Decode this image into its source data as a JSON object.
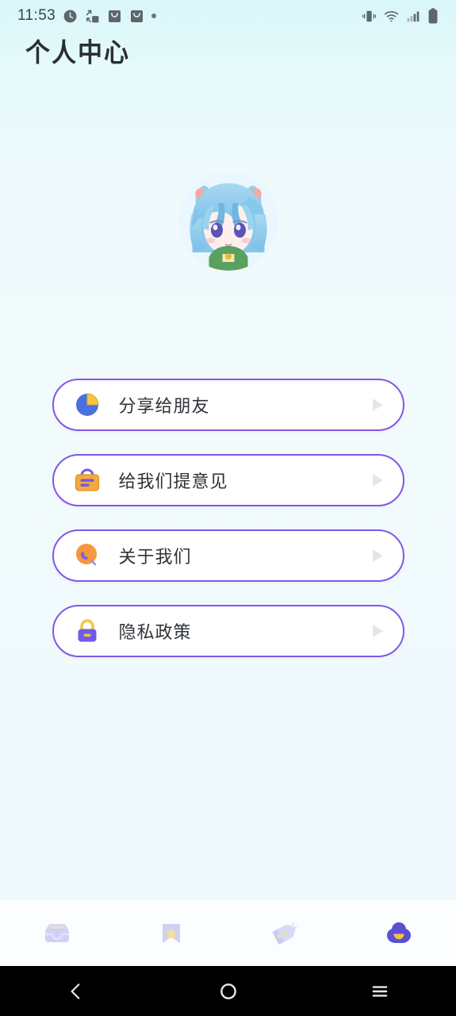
{
  "status_bar": {
    "time": "11:53",
    "left_icons": [
      "clock-icon",
      "shuffle-icon",
      "download-icon",
      "download-icon",
      "dot-icon"
    ],
    "right_icons": [
      "vibrate-icon",
      "wifi-icon",
      "signal-icon",
      "battery-icon"
    ]
  },
  "header": {
    "title": "个人中心"
  },
  "profile": {
    "avatar_name": "user-avatar",
    "avatar_alt": "anime-character-avatar"
  },
  "menu": {
    "items": [
      {
        "label": "分享给朋友",
        "icon": "share-pie-icon",
        "arrow": "play-arrow-icon"
      },
      {
        "label": "给我们提意见",
        "icon": "feedback-board-icon",
        "arrow": "play-arrow-icon"
      },
      {
        "label": "关于我们",
        "icon": "about-magnifier-icon",
        "arrow": "play-arrow-icon"
      },
      {
        "label": "隐私政策",
        "icon": "privacy-lock-icon",
        "arrow": "play-arrow-icon"
      }
    ]
  },
  "tabbar": {
    "items": [
      {
        "name": "tab-inbox",
        "icon": "inbox-box-icon",
        "active": false
      },
      {
        "name": "tab-favorites",
        "icon": "bookmark-star-icon",
        "active": false
      },
      {
        "name": "tab-tags",
        "icon": "price-tags-icon",
        "active": false
      },
      {
        "name": "tab-profile",
        "icon": "profile-cloud-icon",
        "active": true
      }
    ]
  },
  "navbar": {
    "back": "back-chevron-icon",
    "home": "home-circle-icon",
    "recents": "recents-menu-icon"
  },
  "colors": {
    "accent_purple": "#8257e6",
    "icon_purple": "#6c5ce7",
    "icon_orange": "#f59b3c",
    "icon_yellow": "#f5c542",
    "icon_blue": "#4a6fe0",
    "tab_inactive": "#cfd0f5",
    "tab_active": "#5b4fd4",
    "text_dark": "#2f3337",
    "bg_top": "#d9f6f9",
    "bg_bottom": "#eff9fb"
  }
}
